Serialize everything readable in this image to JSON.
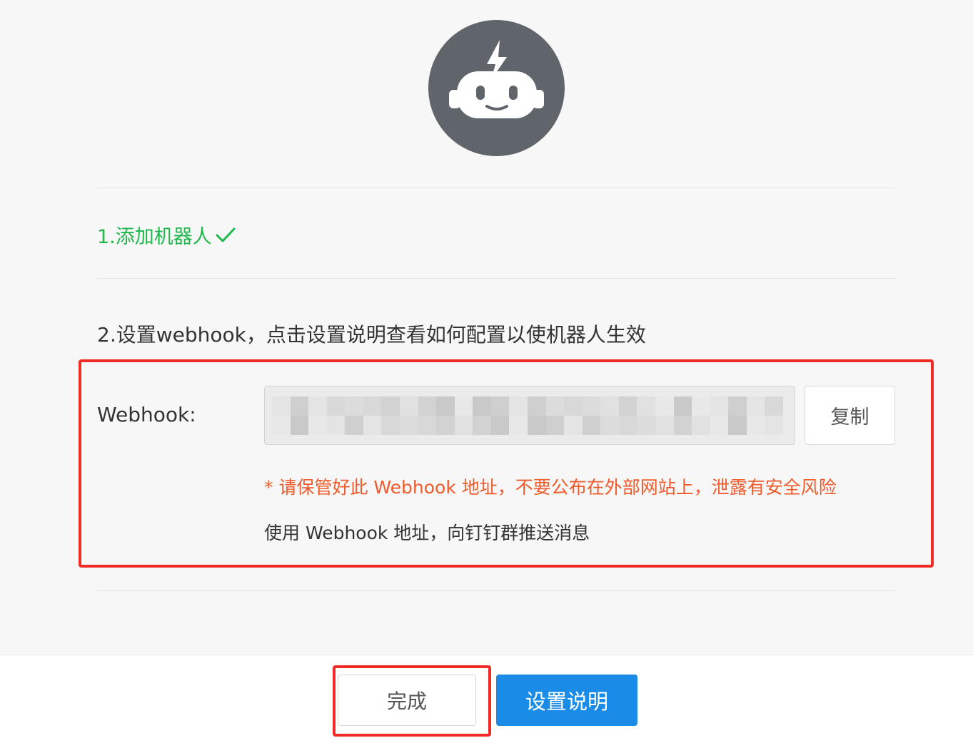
{
  "header": {
    "avatar_icon": "robot-icon"
  },
  "steps": {
    "step1": {
      "text": "1.添加机器人",
      "status_icon": "check-icon",
      "color": "#1fb84c"
    },
    "step2": {
      "text": "2.设置webhook，点击设置说明查看如何配置以使机器人生效"
    }
  },
  "webhook": {
    "label": "Webhook:",
    "value": "",
    "value_state": "blurred",
    "copy_label": "复制",
    "warning": "* 请保管好此 Webhook 地址，不要公布在外部网站上，泄露有安全风险",
    "usage": "使用 Webhook 地址，向钉钉群推送消息"
  },
  "footer": {
    "done_label": "完成",
    "guide_label": "设置说明"
  },
  "colors": {
    "accent_blue": "#1a8ce8",
    "warning_orange": "#f15a2b",
    "success_green": "#1fb84c",
    "highlight_red": "#f02a24",
    "avatar_gray": "#5f656b"
  }
}
